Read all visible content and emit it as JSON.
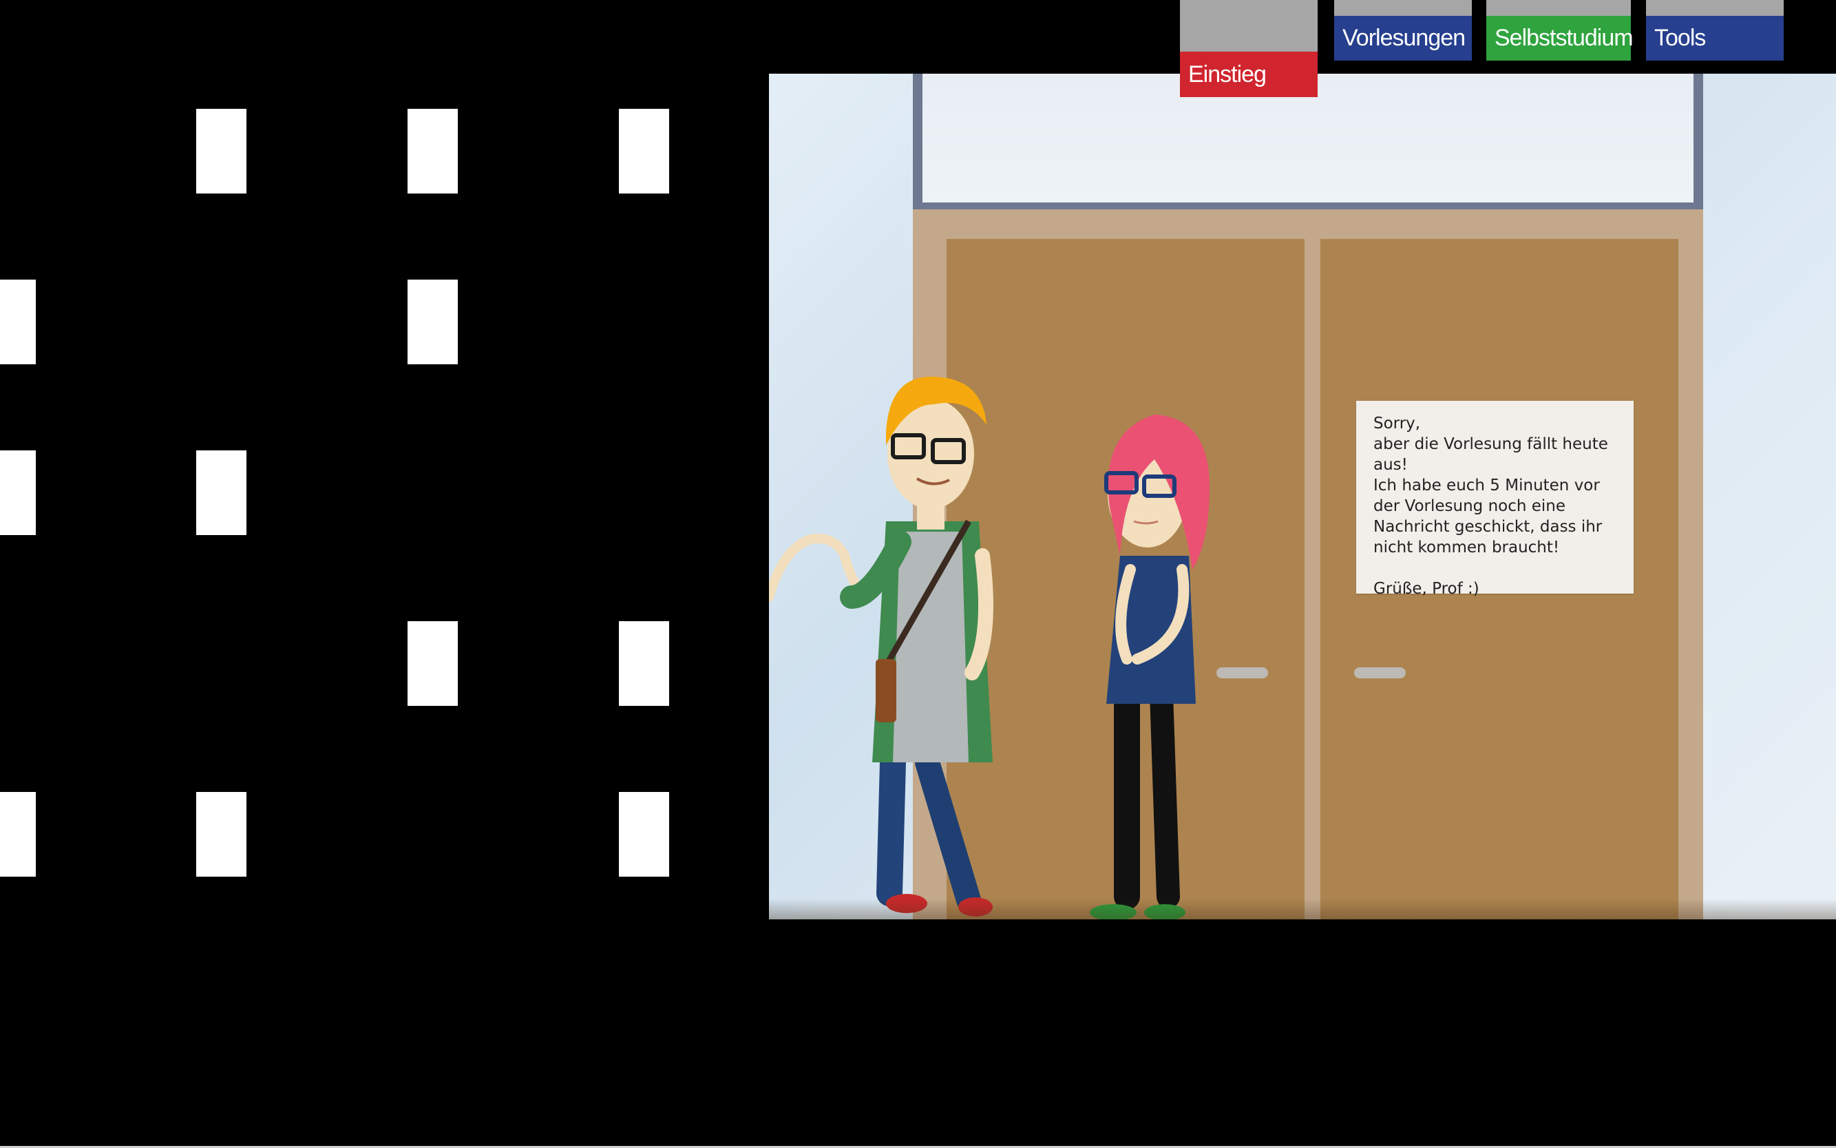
{
  "nav": {
    "items": [
      {
        "label": "Einstieg",
        "color": "#d0252e",
        "active": true
      },
      {
        "label": "Vorlesungen",
        "color": "#263f8e"
      },
      {
        "label": "Selbststudium",
        "color": "#2fa33e"
      },
      {
        "label": "Tools",
        "color": "#263f8e"
      }
    ]
  },
  "scene": {
    "note_text": "Sorry,\naber die Vorlesung fällt heute aus!\nIch habe euch 5 Minuten vor der Vorlesung noch eine Nachricht geschickt, dass ihr nicht kommen braucht!\n\nGrüße, Prof :)"
  },
  "colors": {
    "door": "#ad844f",
    "frame": "#c3a88b",
    "background": "#000000"
  }
}
